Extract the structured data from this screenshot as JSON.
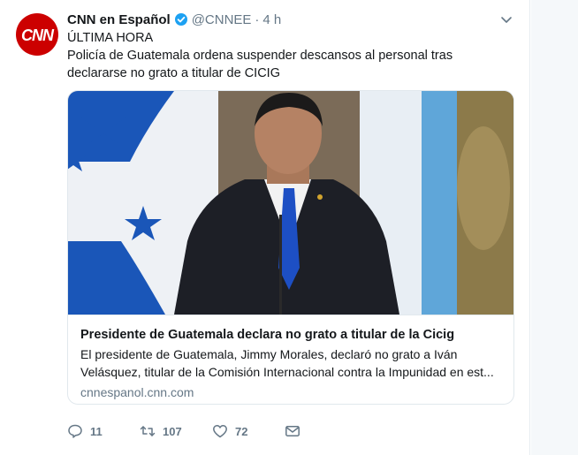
{
  "tweet": {
    "author_name": "CNN en Español",
    "author_handle": "@CNNEE",
    "separator": "·",
    "time": "4 h",
    "text_line1": "ÚLTIMA HORA",
    "text_line2": "Policía de Guatemala ordena suspender descansos al personal tras declararse no grato a titular de CICIG"
  },
  "card": {
    "title": "Presidente de Guatemala declara no grato a titular de la Cicig",
    "description_line1": "El presidente de Guatemala, Jimmy Morales, declaró no grato a Iván",
    "description_line2": "Velásquez, titular de la Comisión Internacional contra la Impunidad en est...",
    "domain": "cnnespanol.cnn.com"
  },
  "actions": {
    "reply_count": "11",
    "retweet_count": "107",
    "like_count": "72"
  },
  "icons": {
    "avatar": "cnn-logo",
    "verified": "verified-badge-icon",
    "caret": "chevron-down-icon",
    "reply": "reply-icon",
    "retweet": "retweet-icon",
    "like": "heart-icon",
    "dm": "envelope-icon"
  },
  "colors": {
    "brand_red": "#cc0000",
    "verified_blue": "#1da1f2",
    "secondary_text": "#657786",
    "border": "#e1e8ed"
  }
}
